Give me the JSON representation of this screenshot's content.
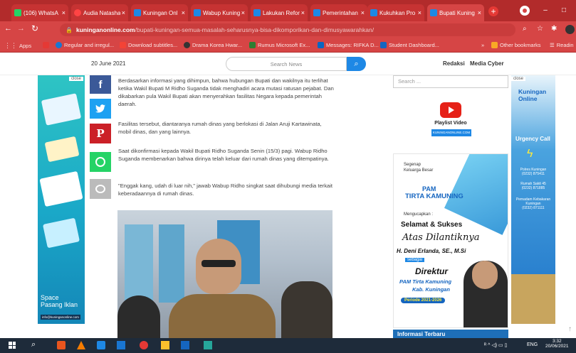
{
  "browser": {
    "tabs": [
      {
        "label": "(106) WhatsA",
        "color": "#25d366"
      },
      {
        "label": "Audia Natasha",
        "color": "#f44"
      },
      {
        "label": "Kuningan Onl",
        "color": "#1e88e5"
      },
      {
        "label": "Wabup Kuning",
        "color": "#1e88e5"
      },
      {
        "label": "Lakukan Refor",
        "color": "#1e88e5"
      },
      {
        "label": "Pemerintahan",
        "color": "#1e88e5"
      },
      {
        "label": "Kukuhkan Pro",
        "color": "#1e88e5"
      },
      {
        "label": "Bupati Kuning",
        "color": "#1e88e5"
      }
    ],
    "url_domain": "kuninganonline.com",
    "url_path": "/bupati-kuningan-semua-masalah-seharusnya-bisa-dikomporikan-dan-dimusyawarahkan/",
    "bookmarks": [
      {
        "label": "Apps",
        "color": "#ffffff"
      },
      {
        "label": "",
        "color": "#e53935"
      },
      {
        "label": "Regular and irregul...",
        "color": "#1976d2"
      },
      {
        "label": "Download subtitles...",
        "color": "#f44336"
      },
      {
        "label": "Drama Korea Hwar...",
        "color": "#333"
      },
      {
        "label": "Rumus Microsoft Ex...",
        "color": "#2e7d32"
      },
      {
        "label": "Messages: RIFKA D...",
        "color": "#0a66c2"
      },
      {
        "label": "Student Dashboard...",
        "color": "#1565c0"
      }
    ],
    "other_bookmarks": "Other bookmarks",
    "reading": "Readin",
    "more": "»"
  },
  "site": {
    "date": "20 June 2021",
    "search_placeholder": "Search News",
    "nav": [
      "Redaksi",
      "Media Cyber"
    ]
  },
  "article": {
    "paragraphs": [
      "Berdasarkan informasi yang dihimpun, bahwa hubungan Bupati dan wakilnya itu terlihat ketika Wakil Bupati M Ridho Suganda tidak menghadiri acara mutasi ratusan pejabat. Dan dikabarkan pula Wakil Bupati akan menyerahkan fasilitas Negara kepada pemerintah daerah.",
      "Fasilitas tersebut, diantaranya rumah dinas yang berlokasi di Jalan Aruji Kartawinata, mobil dinas, dan yang lainnya.",
      "Saat dikonfirmasi kepada Wakil Bupati Ridho Suganda Senin (15/3) pagi. Wabup Ridho Suganda membenarkan bahwa dirinya telah keluar dari rumah dinas yang ditempatinya.",
      "\"Enggak kang, udah di luar nih,\" jawab Wabup Ridho singkat saat dihubungi media terkait keberadaannya di rumah dinas."
    ]
  },
  "left_ad": {
    "close": "close",
    "title_1": "Space",
    "title_2": "Pasang Iklan",
    "email": "info@kuninganonline.com"
  },
  "sidebar": {
    "search_placeholder": "Search ...",
    "playlist": "Playlist Video",
    "playlist_site": "KUNINGANONLINE.COM",
    "ad_lines": {
      "segenap": "Segenap",
      "keluarga": "Keluarga Besar",
      "pam": "PAM",
      "tirta": "TIRTA KAMUNING",
      "mengucapkan": "Mengucapkan :",
      "selamat": "Selamat & Sukses",
      "atas": "Atas Dilantiknya",
      "name": "H. Deni Erlanda, SE., M.Si",
      "sebagai": "sebagai",
      "direktur": "Direktur",
      "pam_full": "PAM Tirta Kamuning",
      "kab": "Kab. Kuningan",
      "periode": "Periode 2021-2026"
    },
    "info": "Informasi Terbaru"
  },
  "right_ad": {
    "close": "close",
    "brand_1": "Kuningan",
    "brand_2": "Online",
    "urgency": "Urgency Call",
    "polres": "Polres Kuningan",
    "polres_no": "(0232) 875411",
    "rs": "Rumah Sakit 45",
    "rs_no": "(0232) 871885",
    "damkar": "Pemadam Kebakaran Kuningan",
    "damkar_no": "(0232) 871111"
  },
  "taskbar": {
    "lang": "ENG",
    "time": "3:32",
    "date": "20/06/2021"
  },
  "colors": {
    "chrome_red": "#d64545",
    "site_blue": "#1e88e5",
    "fb": "#3b5998",
    "tw": "#1da1f2",
    "pin": "#cb2027",
    "wa": "#25d366"
  }
}
